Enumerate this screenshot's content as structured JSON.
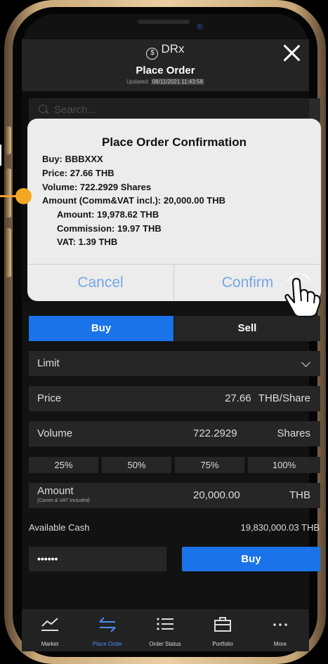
{
  "app": {
    "brand": "DRx",
    "title": "Place Order",
    "updated_label": "Updated:",
    "updated_time": "08/11/2021 11:43:58"
  },
  "search": {
    "placeholder": "Search..."
  },
  "side_toggle": {
    "buy": "Buy",
    "sell": "Sell"
  },
  "order_type": {
    "value": "Limit"
  },
  "price": {
    "label": "Price",
    "value": "27.66",
    "unit": "THB/Share"
  },
  "volume": {
    "label": "Volume",
    "value": "722.2929",
    "unit": "Shares"
  },
  "percent_buttons": [
    "25%",
    "50%",
    "75%",
    "100%"
  ],
  "amount": {
    "label": "Amount",
    "sublabel": "(Comm & VAT Included)",
    "value": "20,000.00",
    "unit": "THB"
  },
  "cash": {
    "label": "Available Cash",
    "value": "19,830,000.03 THB"
  },
  "pin": {
    "value": "••••••"
  },
  "buy_button": "Buy",
  "tabs": [
    {
      "label": "Market",
      "icon": "chart-icon"
    },
    {
      "label": "Place Order",
      "icon": "swap-arrows-icon"
    },
    {
      "label": "Order Status",
      "icon": "list-icon"
    },
    {
      "label": "Portfolio",
      "icon": "briefcase-icon"
    },
    {
      "label": "More",
      "icon": "more-dots-icon"
    }
  ],
  "dialog": {
    "title": "Place Order Confirmation",
    "buy": "Buy: BBBXXX",
    "price": "Price: 27.66 THB",
    "volume": "Volume: 722.2929 Shares",
    "amount_total": "Amount (Comm&VAT incl.): 20,000.00 THB",
    "amount": "Amount: 19,978.62 THB",
    "commission": "Commission: 19.97 THB",
    "vat": "VAT: 1.39 THB",
    "cancel": "Cancel",
    "confirm": "Confirm"
  },
  "colors": {
    "accent": "#1a73e8",
    "active_tab": "#4a8df6",
    "dialog_button": "#75a6e8",
    "annotation": "#f5a623"
  }
}
